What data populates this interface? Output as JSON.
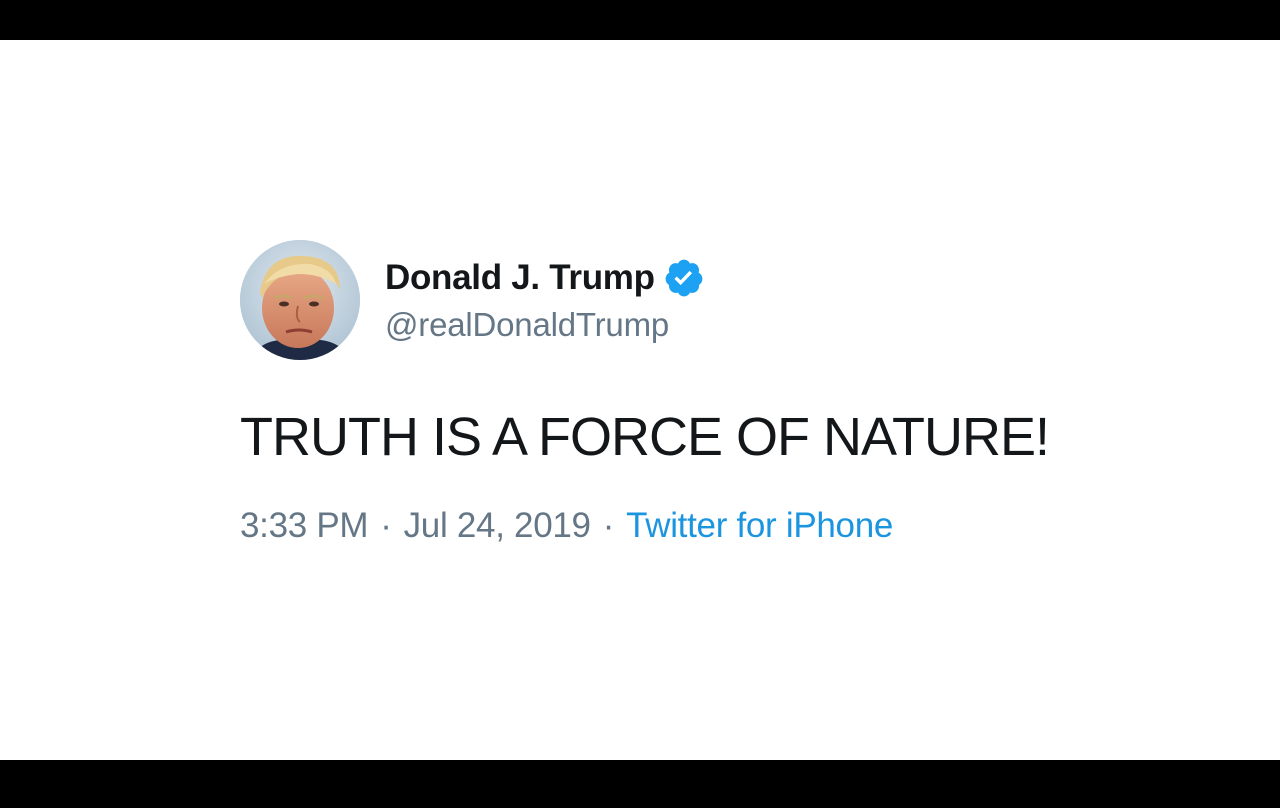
{
  "tweet": {
    "author": {
      "display_name": "Donald J. Trump",
      "handle": "@realDonaldTrump",
      "verified": true,
      "avatar_icon": "profile-photo"
    },
    "text": "TRUTH IS A FORCE OF NATURE!",
    "time": "3:33 PM",
    "separator": "·",
    "date": "Jul 24, 2019",
    "source": "Twitter for iPhone"
  },
  "colors": {
    "verified_badge": "#1da1f2",
    "source_link": "#1b95e0",
    "secondary_text": "#657786",
    "primary_text": "#14171a",
    "letterbox": "#000000",
    "background": "#ffffff"
  }
}
